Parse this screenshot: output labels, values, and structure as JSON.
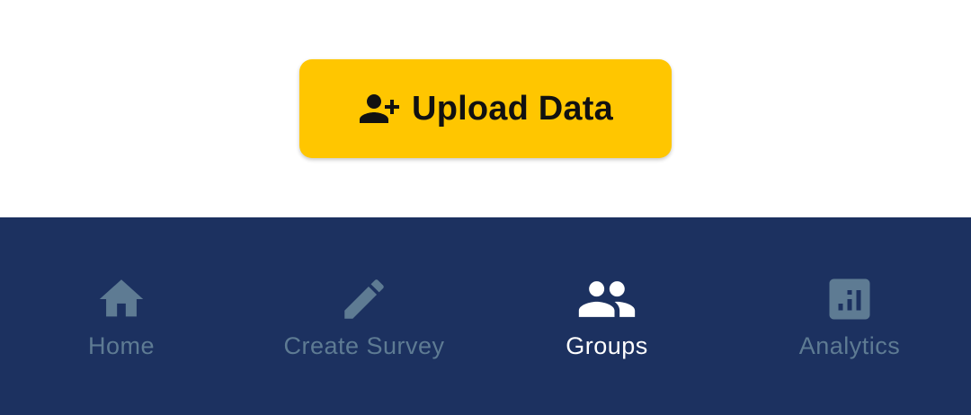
{
  "main": {
    "upload_button": {
      "label": "Upload Data",
      "icon": "person-add-icon",
      "background": "#ffc600"
    }
  },
  "bottom_nav": {
    "background": "#1c3160",
    "active_color": "#ffffff",
    "inactive_color": "#5e7b93",
    "items": [
      {
        "label": "Home",
        "icon": "home-icon",
        "active": false
      },
      {
        "label": "Create Survey",
        "icon": "pencil-icon",
        "active": false
      },
      {
        "label": "Groups",
        "icon": "groups-icon",
        "active": true
      },
      {
        "label": "Analytics",
        "icon": "analytics-icon",
        "active": false
      }
    ]
  }
}
